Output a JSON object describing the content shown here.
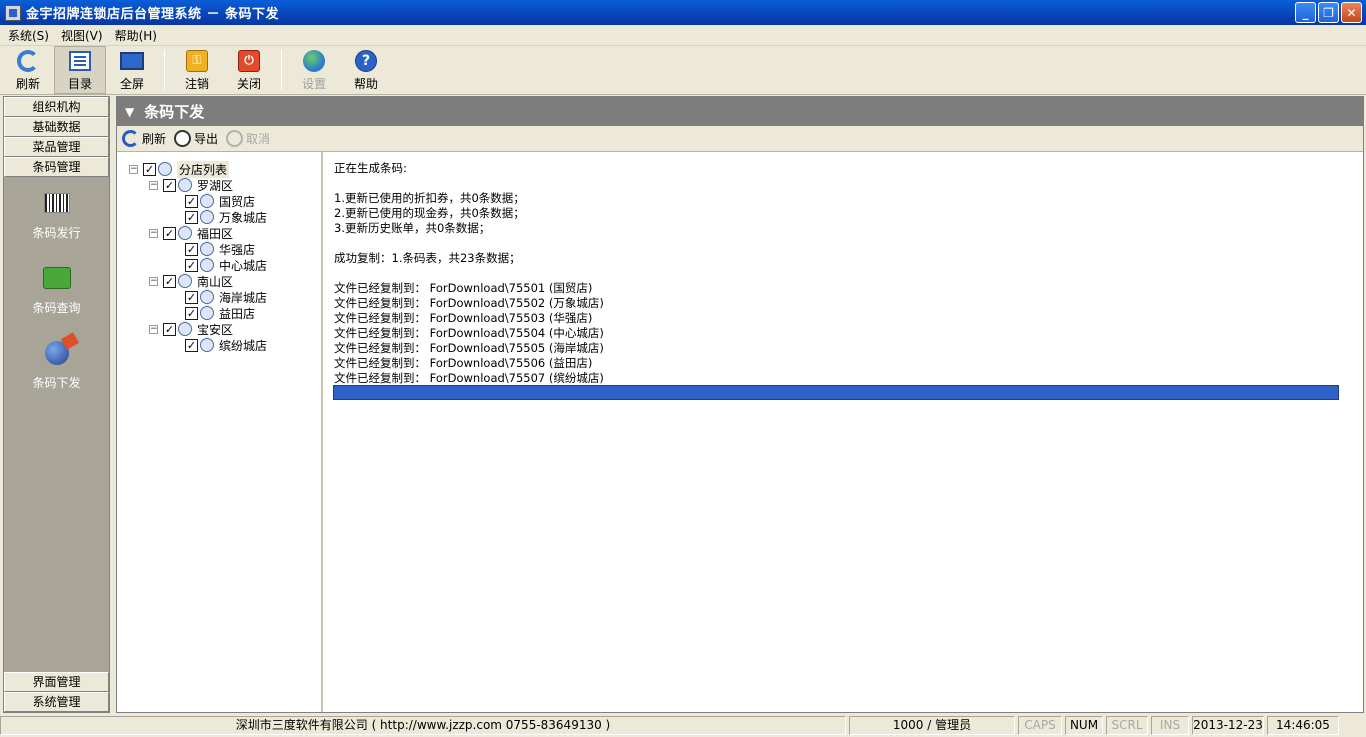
{
  "window": {
    "title": "金宇招牌连锁店后台管理系统 － 条码下发",
    "controls": {
      "minimize": "_",
      "maximize": "❐",
      "close": "✕"
    }
  },
  "menu": [
    "系统(S)",
    "视图(V)",
    "帮助(H)"
  ],
  "toolbar": {
    "buttons": [
      {
        "label": "刷新",
        "icon": "refresh-icon"
      },
      {
        "label": "目录",
        "icon": "directory-icon"
      },
      {
        "label": "全屏",
        "icon": "fullscreen-icon"
      },
      {
        "label": "注销",
        "icon": "logout-key-icon"
      },
      {
        "label": "关闭",
        "icon": "power-icon"
      },
      {
        "label": "设置",
        "icon": "globe-icon"
      },
      {
        "label": "帮助",
        "icon": "help-icon"
      }
    ]
  },
  "sidebar": {
    "categories_top": [
      "组织机构",
      "基础数据",
      "菜品管理",
      "条码管理"
    ],
    "tools": [
      {
        "label": "条码发行",
        "icon": "barcode-icon"
      },
      {
        "label": "条码查询",
        "icon": "scanner-icon"
      },
      {
        "label": "条码下发",
        "icon": "send-icon"
      }
    ],
    "categories_bottom": [
      "界面管理",
      "系统管理"
    ]
  },
  "panel": {
    "title": "条码下发",
    "toolbar": {
      "refresh": "刷新",
      "export": "导出",
      "cancel": "取消"
    }
  },
  "tree": {
    "root": "分店列表",
    "districts": [
      {
        "name": "罗湖区",
        "stores": [
          "国贸店",
          "万象城店"
        ]
      },
      {
        "name": "福田区",
        "stores": [
          "华强店",
          "中心城店"
        ]
      },
      {
        "name": "南山区",
        "stores": [
          "海岸城店",
          "益田店"
        ]
      },
      {
        "name": "宝安区",
        "stores": [
          "缤纷城店"
        ]
      }
    ]
  },
  "log": {
    "heading": "正在生成条码:",
    "updates": [
      "1.更新已使用的折扣券，共0条数据；",
      "2.更新已使用的现金券，共0条数据；",
      "3.更新历史账单，共0条数据；"
    ],
    "copy_success": "成功复制：1.条码表，共23条数据；",
    "copied_files": [
      "文件已经复制到： ForDownload\\75501 (国贸店)",
      "文件已经复制到： ForDownload\\75502 (万象城店)",
      "文件已经复制到： ForDownload\\75503 (华强店)",
      "文件已经复制到： ForDownload\\75504 (中心城店)",
      "文件已经复制到： ForDownload\\75505 (海岸城店)",
      "文件已经复制到： ForDownload\\75506 (益田店)",
      "文件已经复制到： ForDownload\\75507 (缤纷城店)"
    ],
    "progress_fraction": 1.0
  },
  "statusbar": {
    "company": "深圳市三度软件有限公司 ( http://www.jzzp.com  0755-83649130 )",
    "user": "1000 / 管理员",
    "caps": "CAPS",
    "num": "NUM",
    "scrl": "SCRL",
    "ins": "INS",
    "date": "2013-12-23",
    "time": "14:46:05"
  },
  "colors": {
    "titlebar": "#0844b8",
    "panel_header": "#7d7d7d",
    "progress": "#2f62c8"
  }
}
